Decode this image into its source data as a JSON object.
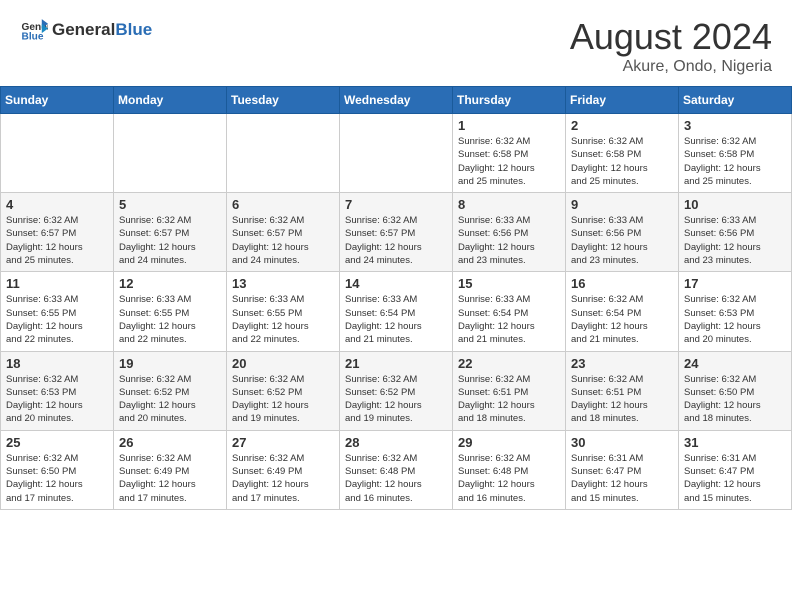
{
  "header": {
    "logo_general": "General",
    "logo_blue": "Blue",
    "month_year": "August 2024",
    "location": "Akure, Ondo, Nigeria"
  },
  "weekdays": [
    "Sunday",
    "Monday",
    "Tuesday",
    "Wednesday",
    "Thursday",
    "Friday",
    "Saturday"
  ],
  "weeks": [
    [
      {
        "day": "",
        "info": ""
      },
      {
        "day": "",
        "info": ""
      },
      {
        "day": "",
        "info": ""
      },
      {
        "day": "",
        "info": ""
      },
      {
        "day": "1",
        "info": "Sunrise: 6:32 AM\nSunset: 6:58 PM\nDaylight: 12 hours\nand 25 minutes."
      },
      {
        "day": "2",
        "info": "Sunrise: 6:32 AM\nSunset: 6:58 PM\nDaylight: 12 hours\nand 25 minutes."
      },
      {
        "day": "3",
        "info": "Sunrise: 6:32 AM\nSunset: 6:58 PM\nDaylight: 12 hours\nand 25 minutes."
      }
    ],
    [
      {
        "day": "4",
        "info": "Sunrise: 6:32 AM\nSunset: 6:57 PM\nDaylight: 12 hours\nand 25 minutes."
      },
      {
        "day": "5",
        "info": "Sunrise: 6:32 AM\nSunset: 6:57 PM\nDaylight: 12 hours\nand 24 minutes."
      },
      {
        "day": "6",
        "info": "Sunrise: 6:32 AM\nSunset: 6:57 PM\nDaylight: 12 hours\nand 24 minutes."
      },
      {
        "day": "7",
        "info": "Sunrise: 6:32 AM\nSunset: 6:57 PM\nDaylight: 12 hours\nand 24 minutes."
      },
      {
        "day": "8",
        "info": "Sunrise: 6:33 AM\nSunset: 6:56 PM\nDaylight: 12 hours\nand 23 minutes."
      },
      {
        "day": "9",
        "info": "Sunrise: 6:33 AM\nSunset: 6:56 PM\nDaylight: 12 hours\nand 23 minutes."
      },
      {
        "day": "10",
        "info": "Sunrise: 6:33 AM\nSunset: 6:56 PM\nDaylight: 12 hours\nand 23 minutes."
      }
    ],
    [
      {
        "day": "11",
        "info": "Sunrise: 6:33 AM\nSunset: 6:55 PM\nDaylight: 12 hours\nand 22 minutes."
      },
      {
        "day": "12",
        "info": "Sunrise: 6:33 AM\nSunset: 6:55 PM\nDaylight: 12 hours\nand 22 minutes."
      },
      {
        "day": "13",
        "info": "Sunrise: 6:33 AM\nSunset: 6:55 PM\nDaylight: 12 hours\nand 22 minutes."
      },
      {
        "day": "14",
        "info": "Sunrise: 6:33 AM\nSunset: 6:54 PM\nDaylight: 12 hours\nand 21 minutes."
      },
      {
        "day": "15",
        "info": "Sunrise: 6:33 AM\nSunset: 6:54 PM\nDaylight: 12 hours\nand 21 minutes."
      },
      {
        "day": "16",
        "info": "Sunrise: 6:32 AM\nSunset: 6:54 PM\nDaylight: 12 hours\nand 21 minutes."
      },
      {
        "day": "17",
        "info": "Sunrise: 6:32 AM\nSunset: 6:53 PM\nDaylight: 12 hours\nand 20 minutes."
      }
    ],
    [
      {
        "day": "18",
        "info": "Sunrise: 6:32 AM\nSunset: 6:53 PM\nDaylight: 12 hours\nand 20 minutes."
      },
      {
        "day": "19",
        "info": "Sunrise: 6:32 AM\nSunset: 6:52 PM\nDaylight: 12 hours\nand 20 minutes."
      },
      {
        "day": "20",
        "info": "Sunrise: 6:32 AM\nSunset: 6:52 PM\nDaylight: 12 hours\nand 19 minutes."
      },
      {
        "day": "21",
        "info": "Sunrise: 6:32 AM\nSunset: 6:52 PM\nDaylight: 12 hours\nand 19 minutes."
      },
      {
        "day": "22",
        "info": "Sunrise: 6:32 AM\nSunset: 6:51 PM\nDaylight: 12 hours\nand 18 minutes."
      },
      {
        "day": "23",
        "info": "Sunrise: 6:32 AM\nSunset: 6:51 PM\nDaylight: 12 hours\nand 18 minutes."
      },
      {
        "day": "24",
        "info": "Sunrise: 6:32 AM\nSunset: 6:50 PM\nDaylight: 12 hours\nand 18 minutes."
      }
    ],
    [
      {
        "day": "25",
        "info": "Sunrise: 6:32 AM\nSunset: 6:50 PM\nDaylight: 12 hours\nand 17 minutes."
      },
      {
        "day": "26",
        "info": "Sunrise: 6:32 AM\nSunset: 6:49 PM\nDaylight: 12 hours\nand 17 minutes."
      },
      {
        "day": "27",
        "info": "Sunrise: 6:32 AM\nSunset: 6:49 PM\nDaylight: 12 hours\nand 17 minutes."
      },
      {
        "day": "28",
        "info": "Sunrise: 6:32 AM\nSunset: 6:48 PM\nDaylight: 12 hours\nand 16 minutes."
      },
      {
        "day": "29",
        "info": "Sunrise: 6:32 AM\nSunset: 6:48 PM\nDaylight: 12 hours\nand 16 minutes."
      },
      {
        "day": "30",
        "info": "Sunrise: 6:31 AM\nSunset: 6:47 PM\nDaylight: 12 hours\nand 15 minutes."
      },
      {
        "day": "31",
        "info": "Sunrise: 6:31 AM\nSunset: 6:47 PM\nDaylight: 12 hours\nand 15 minutes."
      }
    ]
  ]
}
